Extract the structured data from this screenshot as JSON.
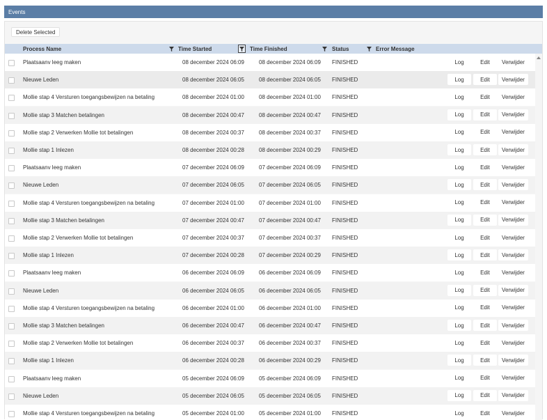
{
  "window": {
    "title": "Events"
  },
  "toolbar": {
    "delete_label": "Delete Selected"
  },
  "columns": {
    "process_name": "Process Name",
    "time_started": "Time Started",
    "time_finished": "Time Finished",
    "status": "Status",
    "error_message": "Error Message"
  },
  "actions": {
    "log": "Log",
    "edit": "Edit",
    "delete": "Verwijder"
  },
  "rows": [
    {
      "name": "Plaatsaanv leeg maken",
      "started": "08 december 2024 06:09",
      "finished": "08 december 2024 06:09",
      "status": "FINISHED"
    },
    {
      "name": "Nieuwe Leden",
      "started": "08 december 2024 06:05",
      "finished": "08 december 2024 06:05",
      "status": "FINISHED"
    },
    {
      "name": "Mollie stap 4 Versturen toegangsbewijzen na betaling",
      "started": "08 december 2024 01:00",
      "finished": "08 december 2024 01:00",
      "status": "FINISHED"
    },
    {
      "name": "Mollie stap 3 Matchen betalingen",
      "started": "08 december 2024 00:47",
      "finished": "08 december 2024 00:47",
      "status": "FINISHED"
    },
    {
      "name": "Mollie stap 2 Verwerken Mollie tot betalingen",
      "started": "08 december 2024 00:37",
      "finished": "08 december 2024 00:37",
      "status": "FINISHED"
    },
    {
      "name": "Mollie stap 1 Inlezen",
      "started": "08 december 2024 00:28",
      "finished": "08 december 2024 00:29",
      "status": "FINISHED"
    },
    {
      "name": "Plaatsaanv leeg maken",
      "started": "07 december 2024 06:09",
      "finished": "07 december 2024 06:09",
      "status": "FINISHED"
    },
    {
      "name": "Nieuwe Leden",
      "started": "07 december 2024 06:05",
      "finished": "07 december 2024 06:05",
      "status": "FINISHED"
    },
    {
      "name": "Mollie stap 4 Versturen toegangsbewijzen na betaling",
      "started": "07 december 2024 01:00",
      "finished": "07 december 2024 01:00",
      "status": "FINISHED"
    },
    {
      "name": "Mollie stap 3 Matchen betalingen",
      "started": "07 december 2024 00:47",
      "finished": "07 december 2024 00:47",
      "status": "FINISHED"
    },
    {
      "name": "Mollie stap 2 Verwerken Mollie tot betalingen",
      "started": "07 december 2024 00:37",
      "finished": "07 december 2024 00:37",
      "status": "FINISHED"
    },
    {
      "name": "Mollie stap 1 Inlezen",
      "started": "07 december 2024 00:28",
      "finished": "07 december 2024 00:29",
      "status": "FINISHED"
    },
    {
      "name": "Plaatsaanv leeg maken",
      "started": "06 december 2024 06:09",
      "finished": "06 december 2024 06:09",
      "status": "FINISHED"
    },
    {
      "name": "Nieuwe Leden",
      "started": "06 december 2024 06:05",
      "finished": "06 december 2024 06:05",
      "status": "FINISHED"
    },
    {
      "name": "Mollie stap 4 Versturen toegangsbewijzen na betaling",
      "started": "06 december 2024 01:00",
      "finished": "06 december 2024 01:00",
      "status": "FINISHED"
    },
    {
      "name": "Mollie stap 3 Matchen betalingen",
      "started": "06 december 2024 00:47",
      "finished": "06 december 2024 00:47",
      "status": "FINISHED"
    },
    {
      "name": "Mollie stap 2 Verwerken Mollie tot betalingen",
      "started": "06 december 2024 00:37",
      "finished": "06 december 2024 00:37",
      "status": "FINISHED"
    },
    {
      "name": "Mollie stap 1 Inlezen",
      "started": "06 december 2024 00:28",
      "finished": "06 december 2024 00:29",
      "status": "FINISHED"
    },
    {
      "name": "Plaatsaanv leeg maken",
      "started": "05 december 2024 06:09",
      "finished": "05 december 2024 06:09",
      "status": "FINISHED"
    },
    {
      "name": "Nieuwe Leden",
      "started": "05 december 2024 06:05",
      "finished": "05 december 2024 06:05",
      "status": "FINISHED"
    },
    {
      "name": "Mollie stap 4 Versturen toegangsbewijzen na betaling",
      "started": "05 december 2024 01:00",
      "finished": "05 december 2024 01:00",
      "status": "FINISHED"
    }
  ],
  "highlighted_row": 1,
  "colors": {
    "titlebar": "#5b7ea6",
    "header": "#cddaeb"
  }
}
